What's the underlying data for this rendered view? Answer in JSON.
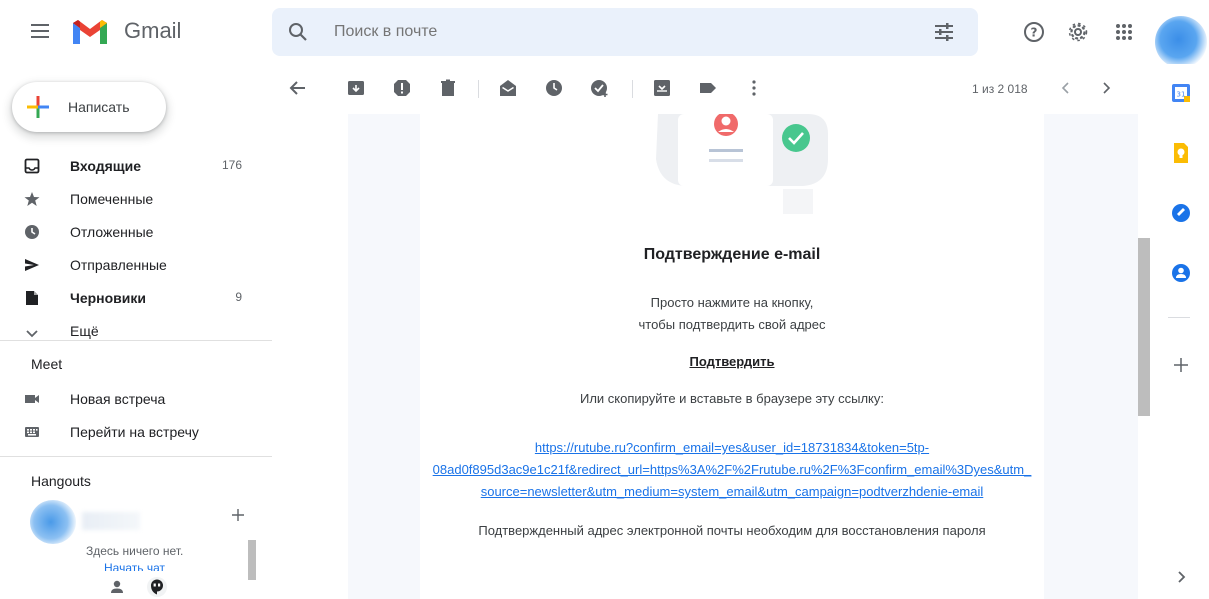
{
  "app": {
    "name": "Gmail"
  },
  "search": {
    "placeholder": "Поиск в почте"
  },
  "compose": {
    "label": "Написать"
  },
  "sidebar": {
    "items": [
      {
        "label": "Входящие",
        "count": "176"
      },
      {
        "label": "Помеченные",
        "count": ""
      },
      {
        "label": "Отложенные",
        "count": ""
      },
      {
        "label": "Отправленные",
        "count": ""
      },
      {
        "label": "Черновики",
        "count": "9"
      },
      {
        "label": "Ещё",
        "count": ""
      }
    ],
    "meet": {
      "title": "Meet",
      "items": [
        {
          "label": "Новая встреча"
        },
        {
          "label": "Перейти на встречу"
        }
      ]
    },
    "hangouts": {
      "title": "Hangouts",
      "empty_text": "Здесь ничего нет.",
      "start_text": "Начать чат"
    }
  },
  "toolbar": {
    "pager": "1 из 2 018"
  },
  "email": {
    "title": "Подтверждение e-mail",
    "line1": "Просто нажмите на кнопку,",
    "line2": "чтобы подтвердить свой адрес",
    "confirm_label": "Подтвердить",
    "copy_text": "Или скопируйте и вставьте в браузере эту ссылку:",
    "link_line1": "https://rutube.ru?confirm_email=yes&user_id=18731834&token=5tp-",
    "link_line2": "08ad0f895d3ac9e1c21f&redirect_url=https%3A%2F%2Frutube.ru%2F%3Fconfirm_email%3Dyes&utm_",
    "link_line3": "source=newsletter&utm_medium=system_email&utm_campaign=podtverzhdenie-email",
    "footer": "Подтвержденный адрес электронной почты необходим для восстановления пароля"
  },
  "colors": {
    "accent": "#1a73e8",
    "search_bg": "#eaf1fb",
    "content_bg": "#f6f8fc"
  }
}
